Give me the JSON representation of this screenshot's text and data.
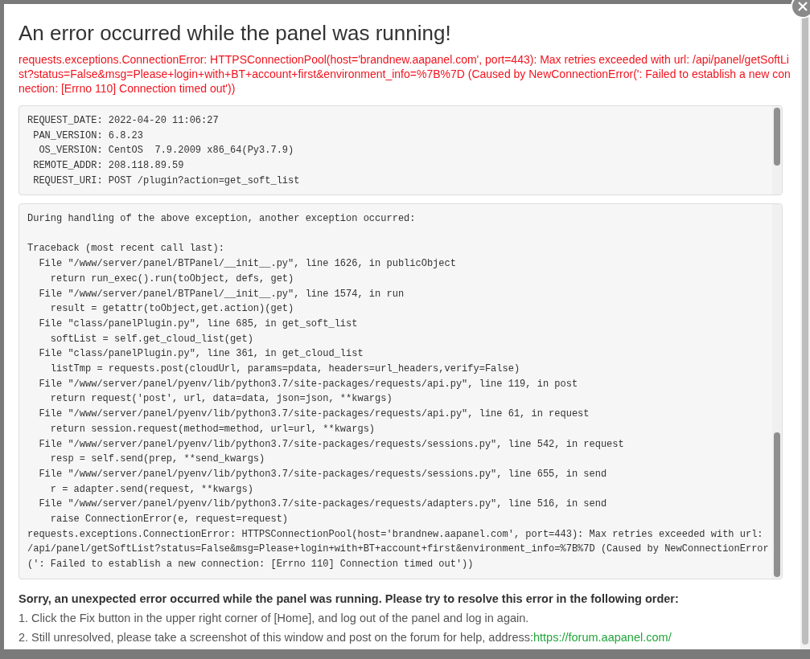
{
  "dialog": {
    "title": "An error occurred while the panel was running!",
    "error_message": "requests.exceptions.ConnectionError: HTTPSConnectionPool(host='brandnew.aapanel.com', port=443): Max retries exceeded with url: /api/panel/getSoftList?status=False&msg=Please+login+with+BT+account+first&environment_info=%7B%7D (Caused by NewConnectionError(': Failed to establish a new connection: [Errno 110] Connection timed out'))",
    "request_info": [
      "REQUEST_DATE: 2022-04-20 11:06:27",
      " PAN_VERSION: 6.8.23",
      "  OS_VERSION: CentOS  7.9.2009 x86_64(Py3.7.9)",
      " REMOTE_ADDR: 208.118.89.59",
      " REQUEST_URI: POST /plugin?action=get_soft_list"
    ],
    "traceback_notice": "During handling of the above exception, another exception occurred:",
    "traceback": [
      "Traceback (most recent call last):",
      "  File \"/www/server/panel/BTPanel/__init__.py\", line 1626, in publicObject",
      "    return run_exec().run(toObject, defs, get)",
      "  File \"/www/server/panel/BTPanel/__init__.py\", line 1574, in run",
      "    result = getattr(toObject,get.action)(get)",
      "  File \"class/panelPlugin.py\", line 685, in get_soft_list",
      "    softList = self.get_cloud_list(get)",
      "  File \"class/panelPlugin.py\", line 361, in get_cloud_list",
      "    listTmp = requests.post(cloudUrl, params=pdata, headers=url_headers,verify=False)",
      "  File \"/www/server/panel/pyenv/lib/python3.7/site-packages/requests/api.py\", line 119, in post",
      "    return request('post', url, data=data, json=json, **kwargs)",
      "  File \"/www/server/panel/pyenv/lib/python3.7/site-packages/requests/api.py\", line 61, in request",
      "    return session.request(method=method, url=url, **kwargs)",
      "  File \"/www/server/panel/pyenv/lib/python3.7/site-packages/requests/sessions.py\", line 542, in request",
      "    resp = self.send(prep, **send_kwargs)",
      "  File \"/www/server/panel/pyenv/lib/python3.7/site-packages/requests/sessions.py\", line 655, in send",
      "    r = adapter.send(request, **kwargs)",
      "  File \"/www/server/panel/pyenv/lib/python3.7/site-packages/requests/adapters.py\", line 516, in send",
      "    raise ConnectionError(e, request=request)",
      "requests.exceptions.ConnectionError: HTTPSConnectionPool(host='brandnew.aapanel.com', port=443): Max retries exceeded with url:",
      "/api/panel/getSoftList?status=False&msg=Please+login+with+BT+account+first&environment_info=%7B%7D (Caused by NewConnectionError",
      "(': Failed to establish a new connection: [Errno 110] Connection timed out'))"
    ],
    "help_heading": "Sorry, an unexpected error occurred while the panel was running. Please try to resolve this error in the following order:",
    "help_steps": [
      {
        "text": "1. Click the Fix button in the upper right corner of [Home], and log out of the panel and log in again."
      },
      {
        "text": "2. Still unresolved, please take a screenshot of this window and post on the forum for help, address:",
        "link": "https://forum.aapanel.com/"
      }
    ]
  }
}
